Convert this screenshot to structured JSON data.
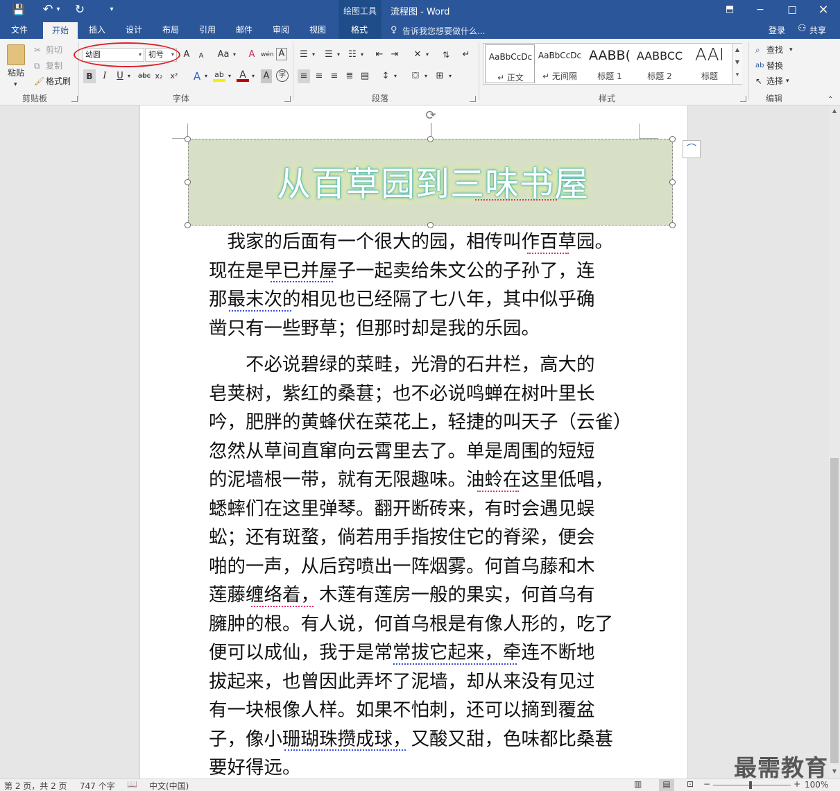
{
  "window": {
    "title": "流程图 - Word",
    "context_tool_group": "绘图工具",
    "minimize": "−",
    "restore": "□",
    "close": "×",
    "ribbon_display": "⬒"
  },
  "qat": {
    "save": "💾",
    "undo": "↶",
    "undo_menu": "▾",
    "redo": "↻",
    "customize": "▾"
  },
  "tabs": [
    {
      "label": "文件"
    },
    {
      "label": "开始"
    },
    {
      "label": "插入"
    },
    {
      "label": "设计"
    },
    {
      "label": "布局"
    },
    {
      "label": "引用"
    },
    {
      "label": "邮件"
    },
    {
      "label": "审阅"
    },
    {
      "label": "视图"
    },
    {
      "label": "格式"
    }
  ],
  "tell_me": "告诉我您想要做什么...",
  "sign_in": "登录",
  "share": "共享",
  "clipboard": {
    "paste": "粘贴",
    "cut": "剪切",
    "copy": "复制",
    "format_painter": "格式刷",
    "label": "剪贴板"
  },
  "font": {
    "name": "幼圆",
    "size": "初号",
    "grow": "A",
    "shrink": "A",
    "change_case": "Aa",
    "clear": "A",
    "phonetic": "wén",
    "enclose": "A",
    "bold": "B",
    "italic": "I",
    "underline": "U",
    "strike": "abc",
    "subscript": "x₂",
    "superscript": "x²",
    "text_effects": "A",
    "highlight": "ab",
    "font_color": "A",
    "char_shading": "A",
    "enclosed_char": "字",
    "label": "字体"
  },
  "paragraph": {
    "label": "段落"
  },
  "styles": {
    "items": [
      {
        "sample": "AaBbCcDc",
        "name": "↵ 正文"
      },
      {
        "sample": "AaBbCcDc",
        "name": "↵ 无间隔"
      },
      {
        "sample": "AABB(",
        "name": "标题 1"
      },
      {
        "sample": "AABBCC",
        "name": "标题 2"
      },
      {
        "sample": "AAI",
        "name": "标题"
      }
    ],
    "label": "样式"
  },
  "editing": {
    "find": "查找",
    "replace": "替换",
    "select": "选择",
    "label": "编辑"
  },
  "document": {
    "title": "从百草园到三味书屋",
    "paragraphs": [
      {
        "lines": [
          "　我家的后面有一个很大的园，相传叫作百草园。",
          "现在是早已并屋子一起卖给朱文公的子孙了，连",
          "那最末次的相见也已经隔了七八年，其中似乎确",
          "凿只有一些野草；但那时却是我的乐园。"
        ]
      },
      {
        "lines": [
          "　　不必说碧绿的菜畦，光滑的石井栏，高大的",
          "皂荚树，紫红的桑葚；也不必说鸣蝉在树叶里长",
          "吟，肥胖的黄蜂伏在菜花上，轻捷的叫天子（云雀）",
          "忽然从草间直窜向云霄里去了。单是周围的短短",
          "的泥墙根一带，就有无限趣味。油蛉在这里低唱，",
          "蟋蟀们在这里弹琴。翻开断砖来，有时会遇见蜈",
          "蚣；还有斑蝥，倘若用手指按住它的脊梁，便会",
          "啪的一声，从后窍喷出一阵烟雾。何首乌藤和木",
          "莲藤缠络着，木莲有莲房一般的果实，何首乌有",
          "臃肿的根。有人说，何首乌根是有像人形的，吃了",
          "便可以成仙，我于是常常拔它起来，牵连不断地",
          "拔起来，也曾因此弄坏了泥墙，却从来没有见过",
          "有一块根像人样。如果不怕刺，还可以摘到覆盆",
          "子，像小珊瑚珠攒成球，又酸又甜，色味都比桑葚",
          "要好得远。"
        ]
      }
    ]
  },
  "status": {
    "page": "第 2 页，共 2 页",
    "words": "747 个字",
    "language": "中文(中国)",
    "zoom": "100%",
    "zoom_minus": "−",
    "zoom_plus": "+"
  },
  "watermark": "最需教育",
  "colors": {
    "ribbon_blue": "#2b579a",
    "annotation_red": "#e0202a",
    "title_box_fill": "#d7e0c7"
  }
}
